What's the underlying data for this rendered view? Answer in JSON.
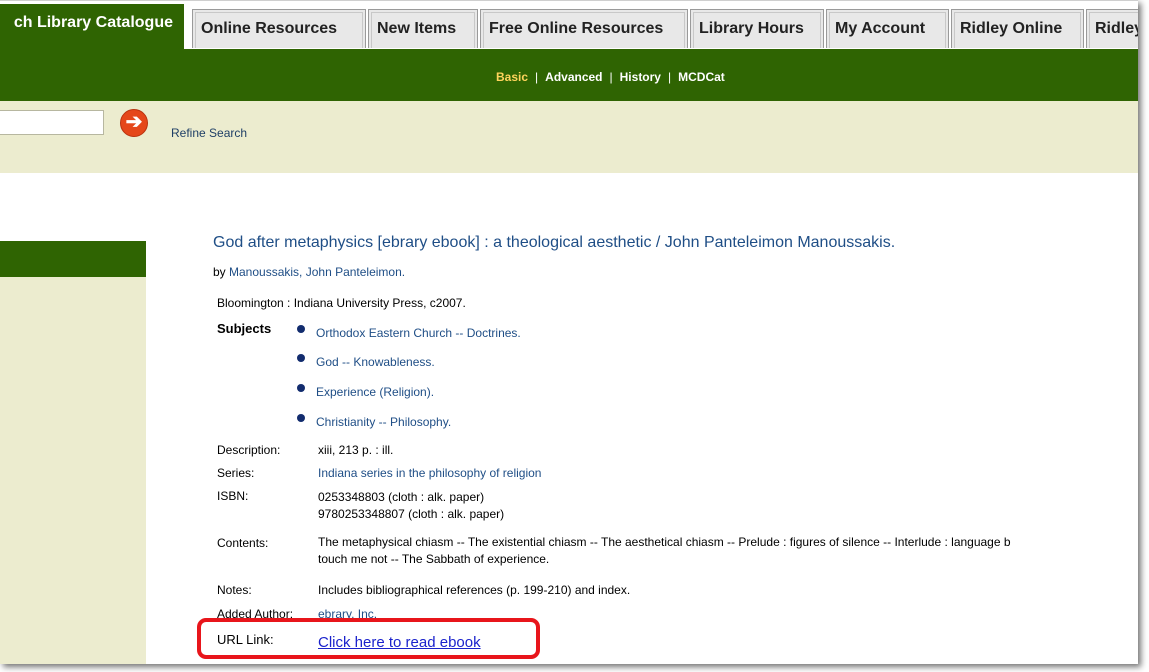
{
  "tabs": [
    {
      "label": "ch Library Catalogue",
      "active": true
    },
    {
      "label": "Online Resources"
    },
    {
      "label": "New Items"
    },
    {
      "label": "Free Online Resources"
    },
    {
      "label": "Library Hours"
    },
    {
      "label": "My Account"
    },
    {
      "label": "Ridley Online"
    },
    {
      "label": "Ridley"
    }
  ],
  "subnav": {
    "basic": "Basic",
    "advanced": "Advanced",
    "history": "History",
    "mcdcat": "MCDCat",
    "separator": "|"
  },
  "search": {
    "value": "",
    "go_icon": "arrow-right-circle-icon",
    "refine": "Refine Search"
  },
  "record": {
    "title": "God after metaphysics [ebrary ebook] : a theological aesthetic / John Panteleimon Manoussakis.",
    "by_prefix": "by ",
    "author": "Manoussakis, John Panteleimon.",
    "publication": "Bloomington : Indiana University Press, c2007.",
    "subjects_label": "Subjects",
    "subjects": [
      "Orthodox Eastern Church -- Doctrines.",
      "God -- Knowableness.",
      "Experience (Religion).",
      "Christianity -- Philosophy."
    ],
    "description_label": "Description:",
    "description": "xiii, 213 p. : ill.",
    "series_label": "Series:",
    "series": "Indiana series in the philosophy of religion",
    "isbn_label": "ISBN:",
    "isbn": [
      "0253348803 (cloth : alk. paper)",
      "9780253348807 (cloth : alk. paper)"
    ],
    "contents_label": "Contents:",
    "contents_line1": "The metaphysical chiasm -- The existential chiasm -- The aesthetical chiasm -- Prelude : figures of silence -- Interlude : language b",
    "contents_line2": "touch me not -- The Sabbath of experience.",
    "notes_label": "Notes:",
    "notes": "Includes bibliographical references (p. 199-210) and index.",
    "added_author_label": "Added Author:",
    "added_author": "ebrary, Inc.",
    "url_label": "URL Link:",
    "url_text": "Click here to read ebook"
  },
  "colors": {
    "nav_green": "#2f6402",
    "band_beige": "#ececcf",
    "link_blue": "#1f4e86",
    "highlight_red": "#e8151b",
    "active_subnav": "#ffd45c"
  }
}
